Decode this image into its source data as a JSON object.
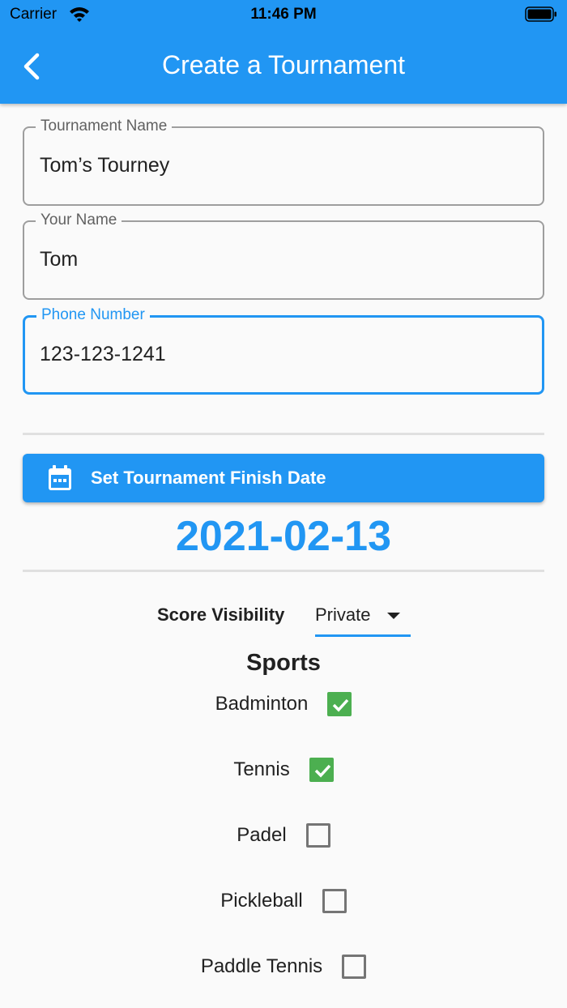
{
  "status_bar": {
    "carrier": "Carrier",
    "time": "11:46 PM"
  },
  "app_bar": {
    "title": "Create a Tournament"
  },
  "form": {
    "tournament_name": {
      "label": "Tournament Name",
      "value": "Tom’s Tourney"
    },
    "your_name": {
      "label": "Your Name",
      "value": "Tom"
    },
    "phone_number": {
      "label": "Phone Number",
      "value": "123-123-1241"
    }
  },
  "finish_date": {
    "button_label": "Set Tournament Finish Date",
    "value": "2021-02-13"
  },
  "score_visibility": {
    "label": "Score Visibility",
    "selected": "Private"
  },
  "sports": {
    "title": "Sports",
    "items": [
      {
        "label": "Badminton",
        "checked": true
      },
      {
        "label": "Tennis",
        "checked": true
      },
      {
        "label": "Padel",
        "checked": false
      },
      {
        "label": "Pickleball",
        "checked": false
      },
      {
        "label": "Paddle Tennis",
        "checked": false
      }
    ]
  },
  "colors": {
    "primary": "#2196f3",
    "checkbox_checked": "#4caf50"
  }
}
